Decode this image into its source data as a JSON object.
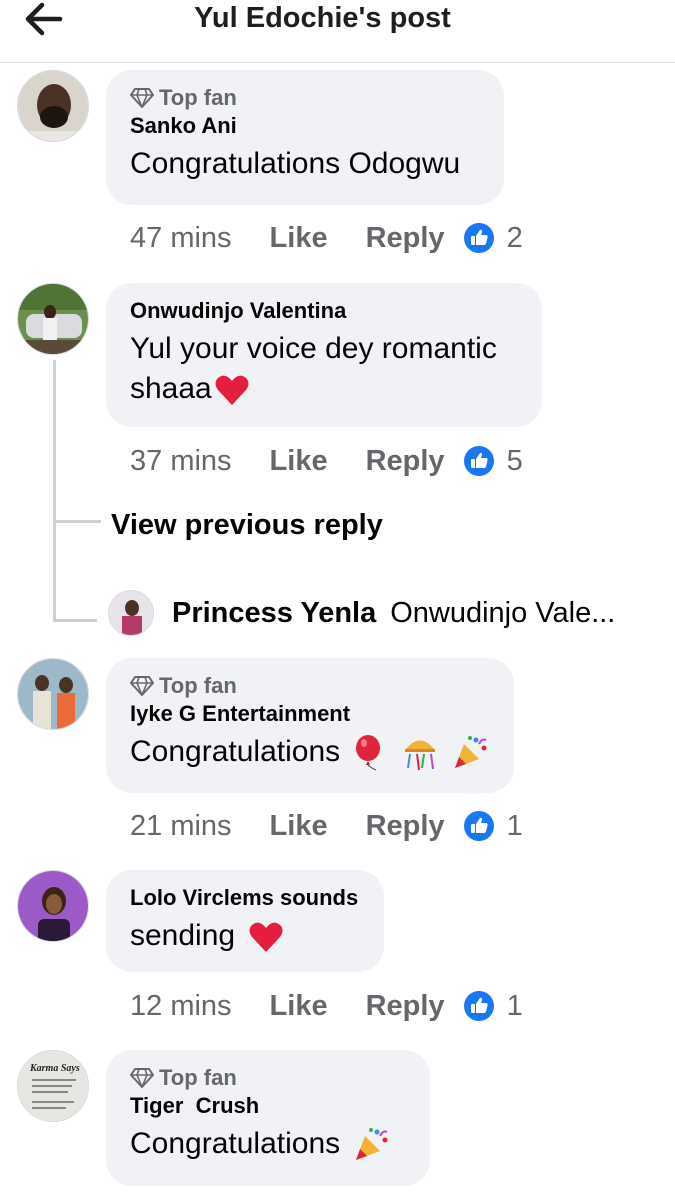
{
  "header": {
    "title": "Yul Edochie's post"
  },
  "comments": [
    {
      "badge": "Top fan",
      "author": "Sanko Ani",
      "text": "Congratulations Odogwu",
      "time": "47 mins",
      "like_label": "Like",
      "reply_label": "Reply",
      "reactions": "2"
    },
    {
      "badge": "",
      "author": "Onwudinjo Valentina",
      "text_line1": "Yul your voice dey romantic",
      "text_line2": "shaaa",
      "time": "37 mins",
      "like_label": "Like",
      "reply_label": "Reply",
      "reactions": "5"
    },
    {
      "badge": "Top fan",
      "author": "Iyke G Entertainment",
      "text": "Congratulations",
      "time": "21 mins",
      "like_label": "Like",
      "reply_label": "Reply",
      "reactions": "1"
    },
    {
      "badge": "",
      "author": "Lolo Virclems sounds",
      "text": "sending",
      "time": "12 mins",
      "like_label": "Like",
      "reply_label": "Reply",
      "reactions": "1"
    },
    {
      "badge": "Top fan",
      "author": "Tiger  Crush",
      "text": "Congratulations"
    }
  ],
  "thread": {
    "view_previous": "View previous reply",
    "reply_author": "Princess Yenla",
    "reply_preview": "Onwudinjo Vale..."
  },
  "avatar_texts": {
    "karma": "Karma Says"
  },
  "colors": {
    "accent": "#1877f2",
    "bubble": "#f0f2f5",
    "meta": "#65676b",
    "heart": "#e41e3f"
  }
}
